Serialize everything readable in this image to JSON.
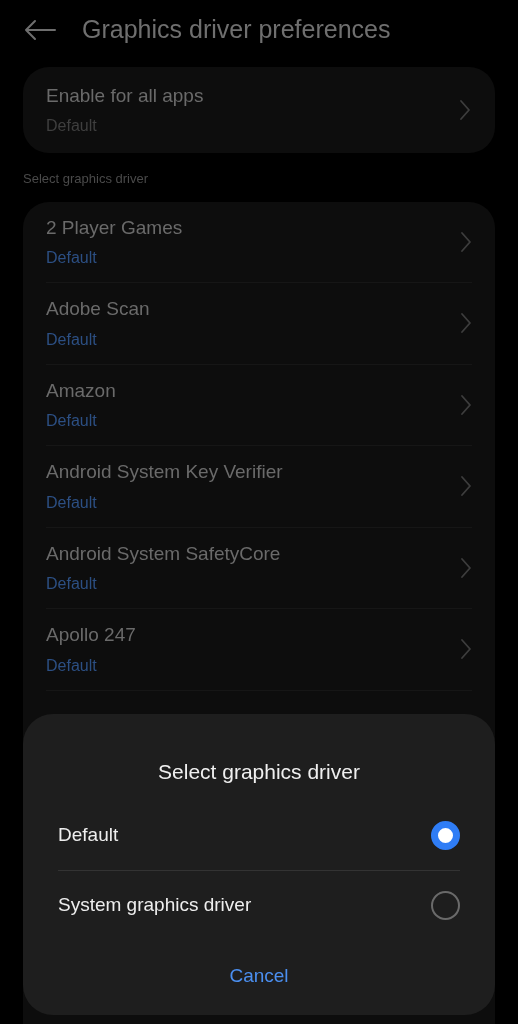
{
  "header": {
    "title": "Graphics driver preferences"
  },
  "global_setting": {
    "title": "Enable for all apps",
    "value": "Default"
  },
  "section_label": "Select graphics driver",
  "apps": [
    {
      "name": "2 Player Games",
      "value": "Default"
    },
    {
      "name": "Adobe Scan",
      "value": "Default"
    },
    {
      "name": "Amazon",
      "value": "Default"
    },
    {
      "name": "Android System Key Verifier",
      "value": "Default"
    },
    {
      "name": "Android System SafetyCore",
      "value": "Default"
    },
    {
      "name": "Apollo 247",
      "value": "Default"
    }
  ],
  "dialog": {
    "title": "Select graphics driver",
    "options": [
      {
        "label": "Default",
        "selected": true
      },
      {
        "label": "System graphics driver",
        "selected": false
      }
    ],
    "cancel": "Cancel"
  }
}
